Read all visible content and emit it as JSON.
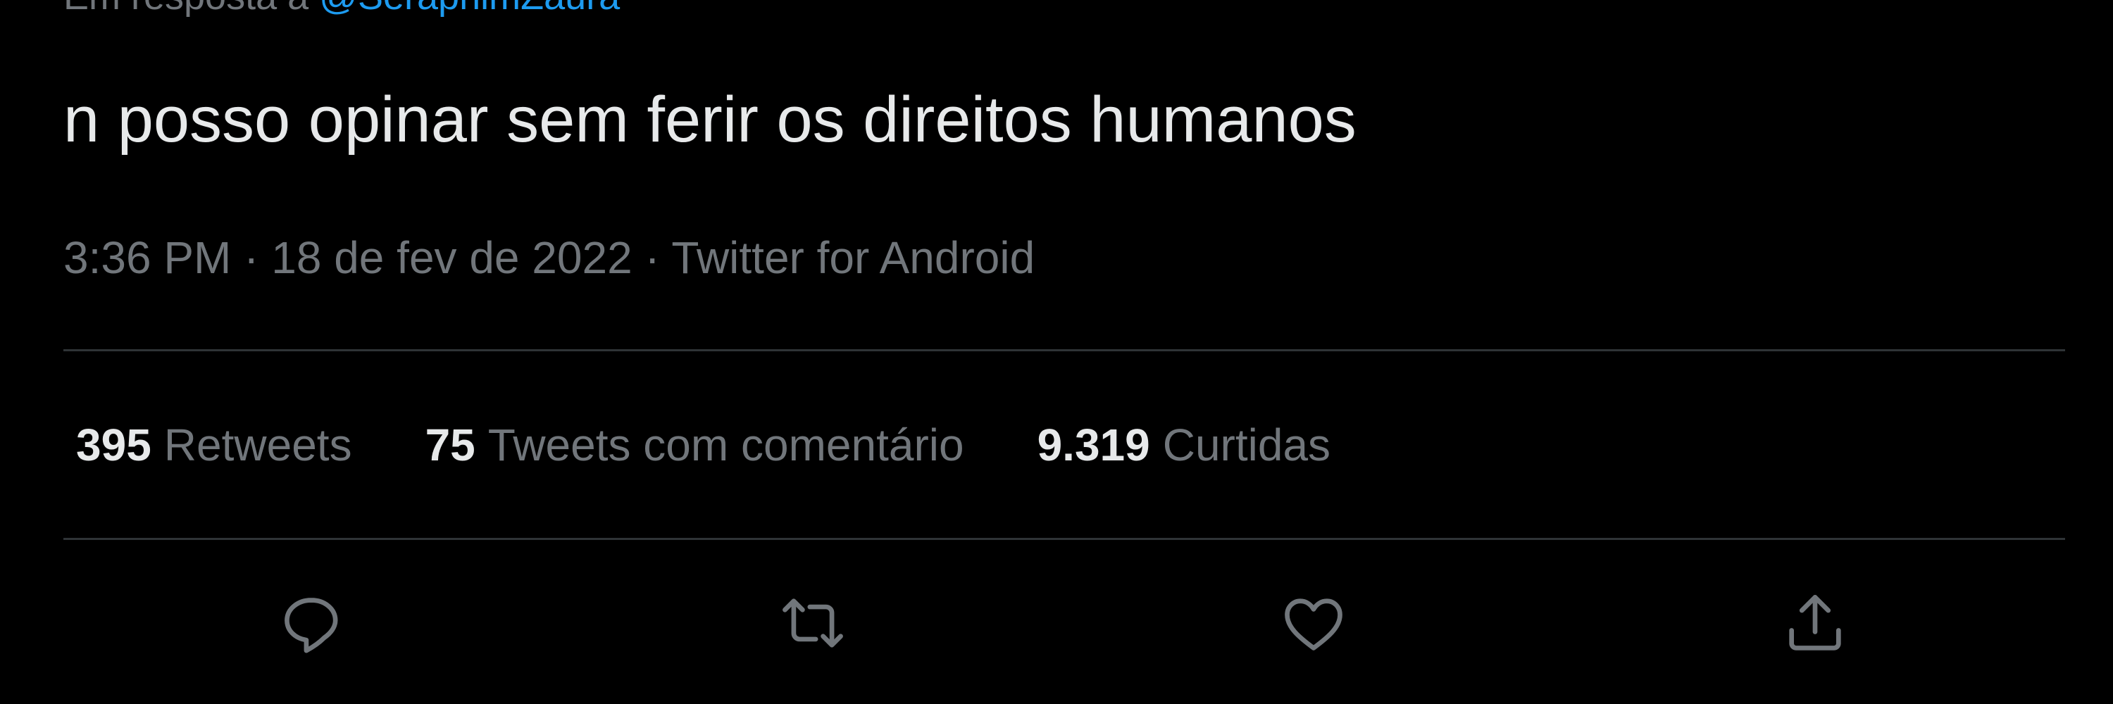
{
  "reply_context": {
    "prefix": "Em resposta a",
    "handle": "@SeraphimZaura"
  },
  "tweet": {
    "text": "n posso opinar sem ferir os direitos humanos",
    "time": "3:36 PM",
    "separator": "·",
    "date": "18 de fev de 2022",
    "source": "Twitter for Android"
  },
  "stats": [
    {
      "count": "395",
      "label": "Retweets"
    },
    {
      "count": "75",
      "label": "Tweets com comentário"
    },
    {
      "count": "9.319",
      "label": "Curtidas"
    }
  ],
  "actions": {
    "reply_icon": "reply-icon",
    "retweet_icon": "retweet-icon",
    "like_icon": "heart-icon",
    "share_icon": "share-icon"
  },
  "colors": {
    "background": "#000000",
    "text_primary": "#e7e9ea",
    "text_secondary": "#71767b",
    "link": "#1d9bf0",
    "divider": "#2f3336"
  }
}
